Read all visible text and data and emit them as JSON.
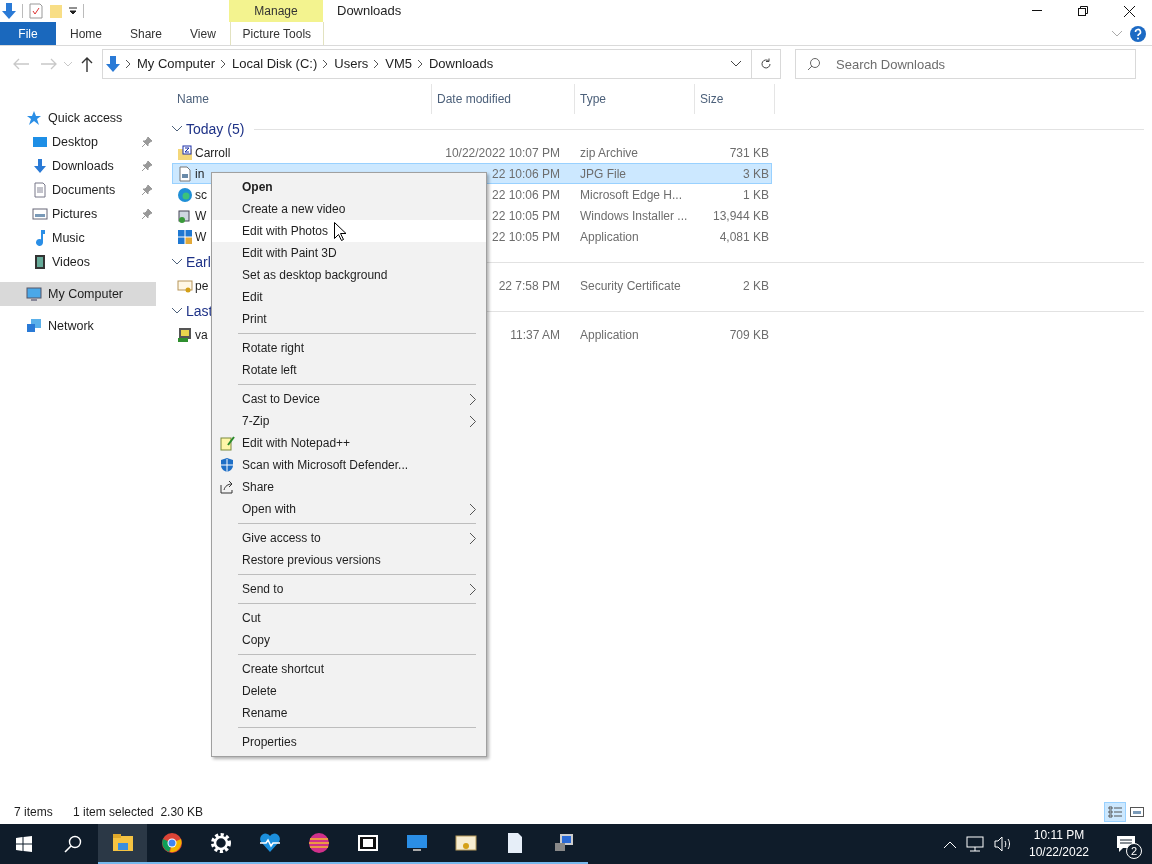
{
  "window": {
    "title": "Downloads",
    "contextual_group": "Manage"
  },
  "ribbon_tabs": [
    {
      "label": "File",
      "kind": "file"
    },
    {
      "label": "Home",
      "kind": "tab"
    },
    {
      "label": "Share",
      "kind": "tab"
    },
    {
      "label": "View",
      "kind": "tab"
    },
    {
      "label": "Picture Tools",
      "kind": "contextual"
    }
  ],
  "breadcrumb": [
    "My Computer",
    "Local Disk (C:)",
    "Users",
    "VM5",
    "Downloads"
  ],
  "search": {
    "placeholder": "Search Downloads"
  },
  "nav": [
    {
      "label": "Quick access",
      "selected": false,
      "children": [
        {
          "label": "Desktop",
          "pinned": true,
          "selected": false
        },
        {
          "label": "Downloads",
          "pinned": true,
          "selected": false
        },
        {
          "label": "Documents",
          "pinned": true,
          "selected": false
        },
        {
          "label": "Pictures",
          "pinned": true,
          "selected": false
        },
        {
          "label": "Music",
          "pinned": false,
          "selected": false
        },
        {
          "label": "Videos",
          "pinned": false,
          "selected": false
        }
      ]
    },
    {
      "label": "My Computer",
      "selected": true
    },
    {
      "label": "Network",
      "selected": false
    }
  ],
  "columns": [
    "Name",
    "Date modified",
    "Type",
    "Size"
  ],
  "groups": [
    {
      "title": "Today (5)",
      "rows": [
        {
          "name": "Carroll",
          "date": "10/22/2022 10:07 PM",
          "type": "zip Archive",
          "size": "731 KB",
          "selected": false
        },
        {
          "name": "in",
          "date": "22 10:06 PM",
          "type": "JPG File",
          "size": "3 KB",
          "selected": true
        },
        {
          "name": "sc",
          "date": "22 10:06 PM",
          "type": "Microsoft Edge H...",
          "size": "1 KB",
          "selected": false
        },
        {
          "name": "W",
          "date": "22 10:05 PM",
          "type": "Windows Installer ...",
          "size": "13,944 KB",
          "selected": false
        },
        {
          "name": "W",
          "date": "22 10:05 PM",
          "type": "Application",
          "size": "4,081 KB",
          "selected": false
        }
      ]
    },
    {
      "title": "Earl",
      "rows": [
        {
          "name": "pe",
          "date": "22 7:58 PM",
          "type": "Security Certificate",
          "size": "2 KB",
          "selected": false
        }
      ]
    },
    {
      "title": "Last",
      "rows": [
        {
          "name": "va",
          "date": "11:37 AM",
          "type": "Application",
          "size": "709 KB",
          "selected": false
        }
      ]
    }
  ],
  "context_menu": [
    {
      "kind": "item",
      "label": "Open",
      "bold": true,
      "submenu": false,
      "selected": false
    },
    {
      "kind": "item",
      "label": "Create a new video",
      "bold": false,
      "submenu": false,
      "selected": false
    },
    {
      "kind": "item",
      "label": "Edit with Photos",
      "bold": false,
      "submenu": false,
      "selected": true
    },
    {
      "kind": "item",
      "label": "Edit with Paint 3D",
      "bold": false,
      "submenu": false,
      "selected": false
    },
    {
      "kind": "item",
      "label": "Set as desktop background",
      "bold": false,
      "submenu": false,
      "selected": false
    },
    {
      "kind": "item",
      "label": "Edit",
      "bold": false,
      "submenu": false,
      "selected": false
    },
    {
      "kind": "item",
      "label": "Print",
      "bold": false,
      "submenu": false,
      "selected": false
    },
    {
      "kind": "separator"
    },
    {
      "kind": "item",
      "label": "Rotate right",
      "bold": false,
      "submenu": false,
      "selected": false
    },
    {
      "kind": "item",
      "label": "Rotate left",
      "bold": false,
      "submenu": false,
      "selected": false
    },
    {
      "kind": "separator"
    },
    {
      "kind": "item",
      "label": "Cast to Device",
      "bold": false,
      "submenu": true,
      "selected": false
    },
    {
      "kind": "item",
      "label": "7-Zip",
      "bold": false,
      "submenu": true,
      "selected": false
    },
    {
      "kind": "item",
      "label": "Edit with Notepad++",
      "bold": false,
      "submenu": false,
      "selected": false
    },
    {
      "kind": "item",
      "label": "Scan with Microsoft Defender...",
      "bold": false,
      "submenu": false,
      "selected": false
    },
    {
      "kind": "item",
      "label": "Share",
      "bold": false,
      "submenu": false,
      "selected": false
    },
    {
      "kind": "item",
      "label": "Open with",
      "bold": false,
      "submenu": true,
      "selected": false
    },
    {
      "kind": "separator"
    },
    {
      "kind": "item",
      "label": "Give access to",
      "bold": false,
      "submenu": true,
      "selected": false
    },
    {
      "kind": "item",
      "label": "Restore previous versions",
      "bold": false,
      "submenu": false,
      "selected": false
    },
    {
      "kind": "separator"
    },
    {
      "kind": "item",
      "label": "Send to",
      "bold": false,
      "submenu": true,
      "selected": false
    },
    {
      "kind": "separator"
    },
    {
      "kind": "item",
      "label": "Cut",
      "bold": false,
      "submenu": false,
      "selected": false
    },
    {
      "kind": "item",
      "label": "Copy",
      "bold": false,
      "submenu": false,
      "selected": false
    },
    {
      "kind": "separator"
    },
    {
      "kind": "item",
      "label": "Create shortcut",
      "bold": false,
      "submenu": false,
      "selected": false
    },
    {
      "kind": "item",
      "label": "Delete",
      "bold": false,
      "submenu": false,
      "selected": false
    },
    {
      "kind": "item",
      "label": "Rename",
      "bold": false,
      "submenu": false,
      "selected": false
    },
    {
      "kind": "separator"
    },
    {
      "kind": "item",
      "label": "Properties",
      "bold": false,
      "submenu": false,
      "selected": false
    }
  ],
  "status_bar": {
    "count": "7 items",
    "selection": "1 item selected  2.30 KB"
  },
  "view_buttons": [
    {
      "selected": true
    },
    {
      "selected": false
    }
  ],
  "taskbar_apps": [
    {
      "selected": true
    },
    {
      "selected": false
    },
    {
      "selected": false
    },
    {
      "selected": false
    },
    {
      "selected": false
    },
    {
      "selected": false
    },
    {
      "selected": false
    },
    {
      "selected": false
    },
    {
      "selected": false
    },
    {
      "selected": false
    }
  ],
  "tray": {
    "time": "10:11 PM",
    "date": "10/22/2022",
    "notifications": "2"
  }
}
